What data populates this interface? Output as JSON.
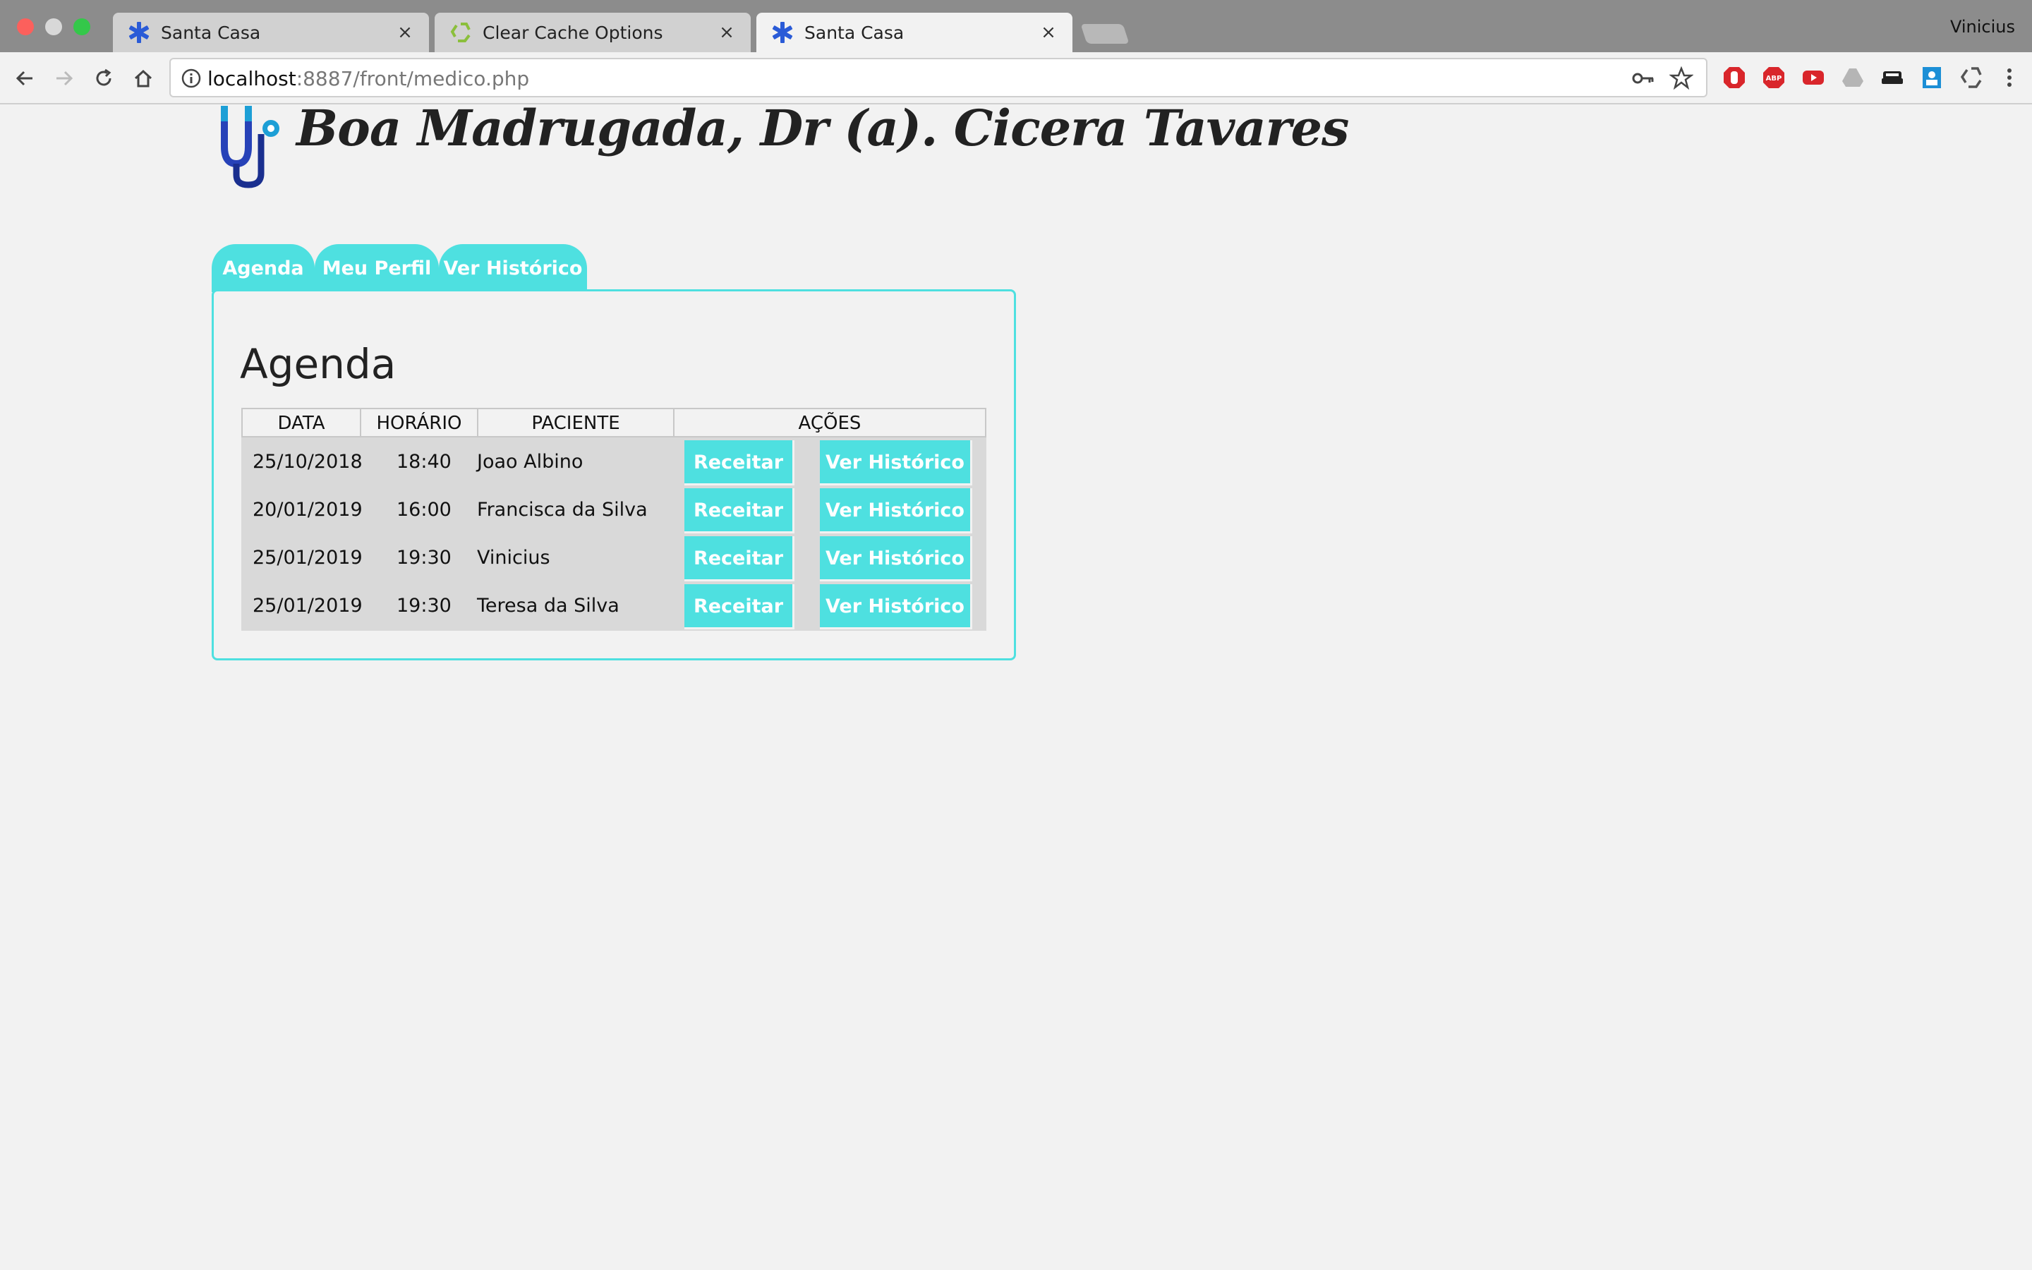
{
  "browser": {
    "tabs": [
      {
        "title": "Santa Casa",
        "icon": "star-of-life-icon",
        "active": false
      },
      {
        "title": "Clear Cache Options",
        "icon": "recycle-icon",
        "active": false
      },
      {
        "title": "Santa Casa",
        "icon": "star-of-life-icon",
        "active": true
      }
    ],
    "profile_name": "Vinicius",
    "url_host": "localhost",
    "url_rest": ":8887/front/medico.php"
  },
  "page": {
    "greeting": "Boa Madrugada, Dr (a). Cicera Tavares",
    "tabs": [
      "Agenda",
      "Meu Perfil",
      "Ver Histórico"
    ],
    "section_title": "Agenda",
    "table": {
      "headers": [
        "DATA",
        "HORÁRIO",
        "PACIENTE",
        "AÇÕES"
      ],
      "rows": [
        {
          "date": "25/10/2018",
          "time": "18:40",
          "patient": "Joao Albino",
          "action1": "Receitar",
          "action2": "Ver Histórico"
        },
        {
          "date": "20/01/2019",
          "time": "16:00",
          "patient": "Francisca da Silva",
          "action1": "Receitar",
          "action2": "Ver Histórico"
        },
        {
          "date": "25/01/2019",
          "time": "19:30",
          "patient": "Vinicius",
          "action1": "Receitar",
          "action2": "Ver Histórico"
        },
        {
          "date": "25/01/2019",
          "time": "19:30",
          "patient": "Teresa da Silva",
          "action1": "Receitar",
          "action2": "Ver Histórico"
        }
      ]
    }
  },
  "colors": {
    "accent": "#4ee0e0",
    "page_bg": "#f2f2f2",
    "table_body_bg": "#d9d9d9"
  }
}
